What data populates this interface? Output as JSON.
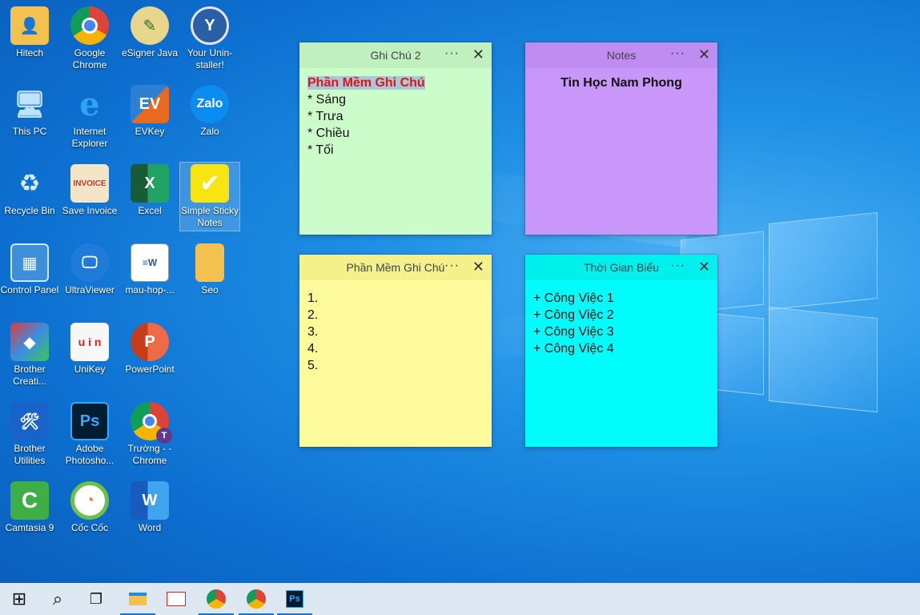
{
  "desktop": {
    "icons": [
      {
        "label": "Hitech"
      },
      {
        "label": "Google Chrome"
      },
      {
        "label": "eSigner Java"
      },
      {
        "label": "Your Unin-staller!"
      },
      {
        "label": "This PC"
      },
      {
        "label": "Internet Explorer"
      },
      {
        "label": "EVKey"
      },
      {
        "label": "Zalo"
      },
      {
        "label": "Recycle Bin"
      },
      {
        "label": "Save Invoice"
      },
      {
        "label": "Excel"
      },
      {
        "label": "Simple Sticky Notes"
      },
      {
        "label": "Control Panel"
      },
      {
        "label": "UltraViewer"
      },
      {
        "label": "mau-hop-..."
      },
      {
        "label": "Seo"
      },
      {
        "label": "Brother Creati..."
      },
      {
        "label": "UniKey"
      },
      {
        "label": "PowerPoint"
      },
      {
        "label": "Brother Utilities"
      },
      {
        "label": "Adobe Photosho..."
      },
      {
        "label": "Trường - - Chrome"
      },
      {
        "label": "Camtasia 9"
      },
      {
        "label": "Cốc Cốc"
      },
      {
        "label": "Word"
      }
    ]
  },
  "notes": [
    {
      "title": "Ghi Chú 2",
      "color": "#ccfcc9",
      "heading": "Phần Mềm Ghi Chú",
      "lines": [
        "* Sáng",
        "* Trưa",
        "* Chiều",
        "* Tối"
      ]
    },
    {
      "title": "Notes",
      "color": "#c897f9",
      "heading": "Tin Học Nam Phong",
      "lines": []
    },
    {
      "title": "Phần Mềm Ghi Chú",
      "color": "#fdfa9c",
      "lines": [
        "1.",
        "2.",
        "3.",
        "4.",
        "5."
      ]
    },
    {
      "title": "Thời Gian Biểu",
      "color": "#00fdfb",
      "lines": [
        "+ Công Việc 1",
        "+ Công Việc 2",
        "+ Công Việc 3",
        "+ Công Việc 4"
      ]
    }
  ],
  "note_controls": {
    "menu": "···",
    "close": "✕"
  },
  "taskbar": {
    "buttons": [
      {
        "name": "start",
        "glyph": "⊞"
      },
      {
        "name": "search",
        "glyph": "⌕"
      },
      {
        "name": "task-view",
        "glyph": "❐"
      }
    ]
  }
}
